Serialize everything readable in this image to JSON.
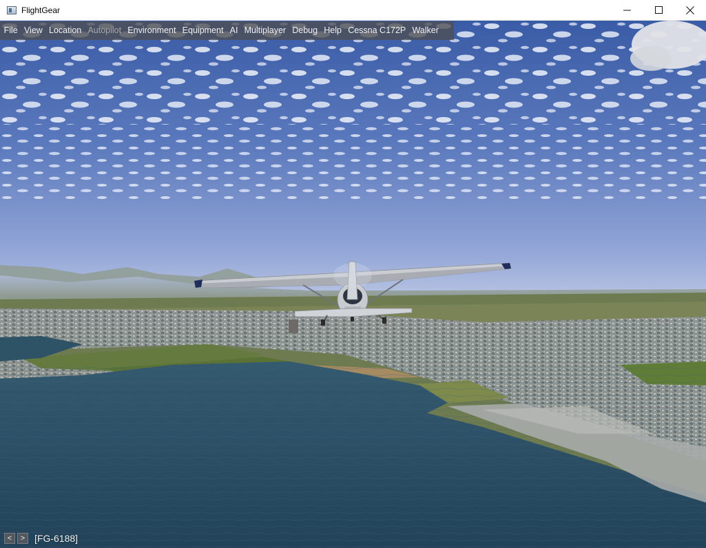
{
  "window": {
    "title": "FlightGear",
    "icon": "app-window-icon",
    "controls": [
      "minimize-icon",
      "maximize-icon",
      "close-icon"
    ]
  },
  "menubar": {
    "items": [
      {
        "label": "File",
        "enabled": true
      },
      {
        "label": "View",
        "enabled": true
      },
      {
        "label": "Location",
        "enabled": true
      },
      {
        "label": "Autopilot",
        "enabled": false
      },
      {
        "label": "Environment",
        "enabled": true
      },
      {
        "label": "Equipment",
        "enabled": true
      },
      {
        "label": "AI",
        "enabled": true
      },
      {
        "label": "Multiplayer",
        "enabled": true
      },
      {
        "label": "Debug",
        "enabled": true
      },
      {
        "label": "Help",
        "enabled": true
      },
      {
        "label": "Cessna C172P",
        "enabled": true
      },
      {
        "label": "Walker",
        "enabled": true
      }
    ]
  },
  "message_bar": {
    "prev_label": "<",
    "next_label": ">",
    "callsign": "[FG-6188]"
  },
  "colors": {
    "sky_top": "#3b5ea8",
    "sky_horizon": "#aebbe0",
    "water": "#2a4d63",
    "land": "#6f7a4c",
    "city": "#9aa0a2"
  }
}
